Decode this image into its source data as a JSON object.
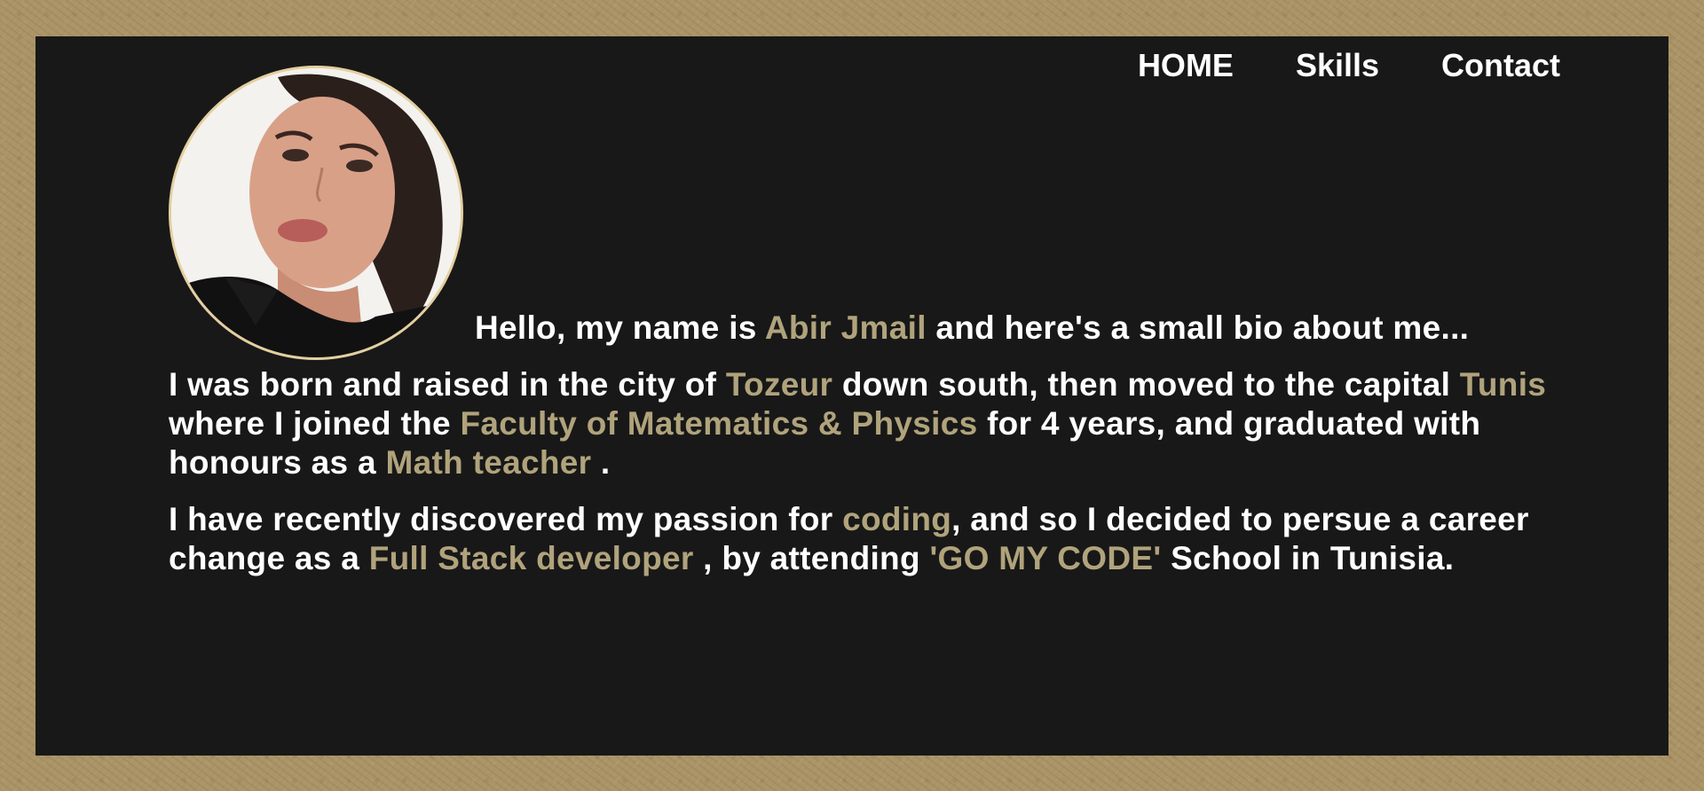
{
  "nav": {
    "home": "HOME",
    "skills": "Skills",
    "contact": "Contact"
  },
  "colors": {
    "accent": "#b0a37c",
    "panel": "#181818",
    "border": "#ab9466",
    "avatar_ring": "#e4cf9f"
  },
  "profile": {
    "avatar_alt": "profile photo"
  },
  "intro": {
    "t1": "Hello, my name is ",
    "name": "Abir Jmail",
    "t2": " and here's a small bio about me..."
  },
  "bio1": {
    "t1": "I was born and raised in the city of ",
    "city": "Tozeur",
    "t2": " down south, then moved to the capital ",
    "capital": "Tunis",
    "t3": " where I joined the ",
    "faculty": "Faculty of Matematics & Physics",
    "t4": " for 4 years, and graduated with honours as a ",
    "role": "Math teacher",
    "t5": " ."
  },
  "bio2": {
    "t1": "I have recently discovered my passion for ",
    "passion": "coding",
    "t2": ", and so I decided to persue a career change as a ",
    "career": "Full Stack developer",
    "t3": " , by attending ",
    "school": "'GO MY CODE'",
    "t4": " School in Tunisia."
  }
}
